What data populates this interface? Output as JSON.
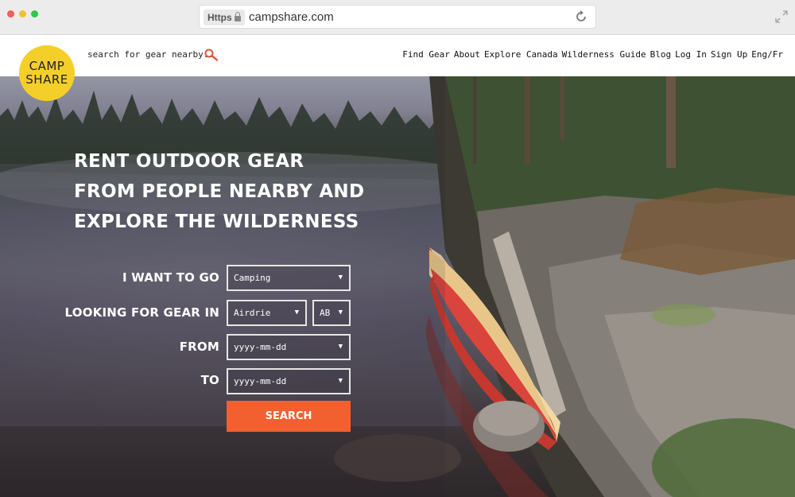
{
  "browser": {
    "protocol": "https",
    "url": "campshare.com"
  },
  "site": {
    "logo_line1": "CAMP",
    "logo_line2": "SHARE",
    "search_hint": "search for gear nearby..",
    "nav": [
      "Find Gear",
      "About",
      "Explore Canada",
      "Wilderness Guide",
      "Blog",
      "Log In",
      "Sign Up",
      "Eng/Fr"
    ]
  },
  "hero": {
    "headline": [
      "RENT OUTDOOR GEAR",
      "FROM PEOPLE NEARBY AND",
      "EXPLORE THE WILDERNESS"
    ]
  },
  "form": {
    "want_label": "I WANT TO GO",
    "want_value": "Camping",
    "looking_label": "LOOKING FOR GEAR IN",
    "city_value": "Airdrie",
    "province_value": "AB",
    "from_label": "FROM",
    "from_placeholder": "yyyy-mm-dd",
    "to_label": "TO",
    "to_placeholder": "yyyy-mm-dd",
    "search_label": "SEARCH"
  },
  "colors": {
    "logo": "#f4cf2a",
    "search_button": "#f2602f",
    "canoe": "#d9443c"
  }
}
